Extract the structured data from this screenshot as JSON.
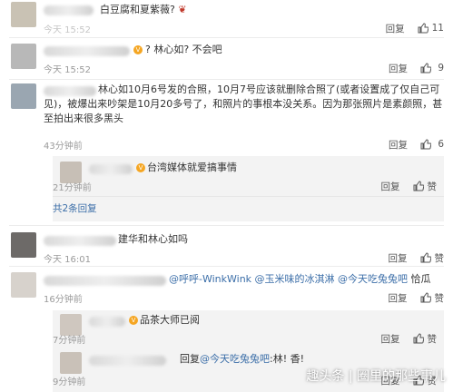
{
  "comments": [
    {
      "text": "白豆腐和夏紫薇?",
      "time": "今天 15:52",
      "reply": "回复",
      "likes": "11"
    },
    {
      "text": "? 林心如? 不会吧",
      "time": "今天 15:52",
      "reply": "回复",
      "likes": "9"
    },
    {
      "text": "林心如10月6号发的合照，10月7号应该就删除合照了(或者设置成了仅自己可见)，被爆出来吵架是10月20多号了，和照片的事根本没关系。因为那张照片是素颜照，甚至拍出来很多黑头",
      "time": "43分钟前",
      "reply": "回复",
      "likes": "6"
    },
    {
      "text": "台湾媒体就爱搞事情",
      "time": "21分钟前",
      "reply": "回复",
      "likes": "赞"
    },
    {
      "more": "共2条回复"
    },
    {
      "text": "建华和林心如吗",
      "time": "今天 16:01",
      "reply": "回复",
      "likes": "赞"
    },
    {
      "mentions": [
        "@呼呼-WinkWink",
        "@玉米味的冰淇淋",
        "@今天吃兔兔吧"
      ],
      "suffix": "恰瓜",
      "time": "16分钟前",
      "reply": "回复",
      "likes": "赞"
    },
    {
      "text": "品茶大师已阅",
      "time": "7分钟前",
      "reply": "回复",
      "likes": "赞"
    },
    {
      "prefix": "回复",
      "mention": "@今天吃兔兔吧",
      "suffix": ":林! 香!",
      "time": "9分钟前",
      "reply": "回复",
      "likes": "赞"
    }
  ],
  "watermark": "趣头条 | 圈里的那些事儿",
  "colors": {
    "link": "#3b6ea8",
    "sub_bg": "#f3f3f3"
  }
}
